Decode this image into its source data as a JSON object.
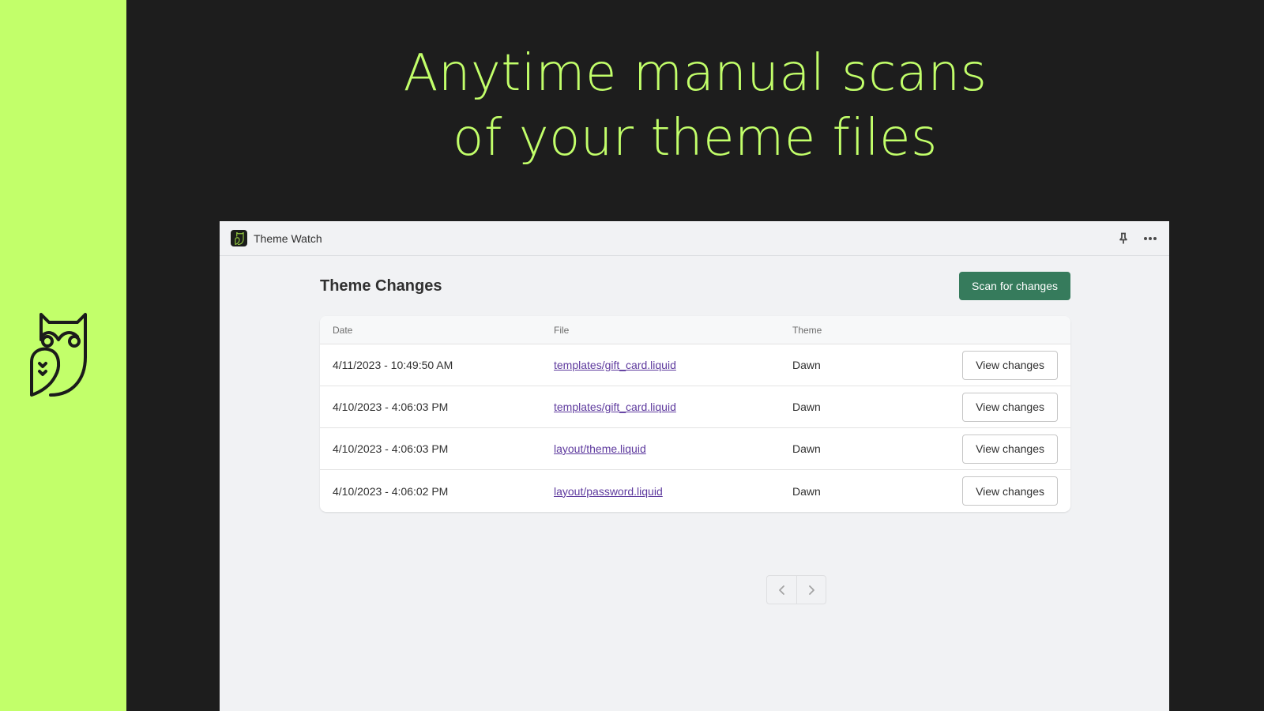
{
  "hero": {
    "line1": "Anytime manual scans",
    "line2": "of your theme files"
  },
  "colors": {
    "brand_lime": "#c2ff6a",
    "background_dark": "#1d1d1d",
    "primary_button": "#367b5c",
    "link": "#5e3a9e"
  },
  "app": {
    "title": "Theme Watch",
    "icons": {
      "app": "owl-icon",
      "pin": "pin-icon",
      "more": "more-horizontal-icon"
    }
  },
  "page": {
    "title": "Theme Changes",
    "scan_button": "Scan for changes"
  },
  "table": {
    "columns": [
      "Date",
      "File",
      "Theme",
      ""
    ],
    "rows": [
      {
        "date": "4/11/2023 - 10:49:50 AM",
        "file": "templates/gift_card.liquid",
        "theme": "Dawn",
        "action": "View changes"
      },
      {
        "date": "4/10/2023 - 4:06:03 PM",
        "file": "templates/gift_card.liquid",
        "theme": "Dawn",
        "action": "View changes"
      },
      {
        "date": "4/10/2023 - 4:06:03 PM",
        "file": "layout/theme.liquid",
        "theme": "Dawn",
        "action": "View changes"
      },
      {
        "date": "4/10/2023 - 4:06:02 PM",
        "file": "layout/password.liquid",
        "theme": "Dawn",
        "action": "View changes"
      }
    ]
  },
  "pagination": {
    "prev_icon": "chevron-left-icon",
    "next_icon": "chevron-right-icon"
  }
}
